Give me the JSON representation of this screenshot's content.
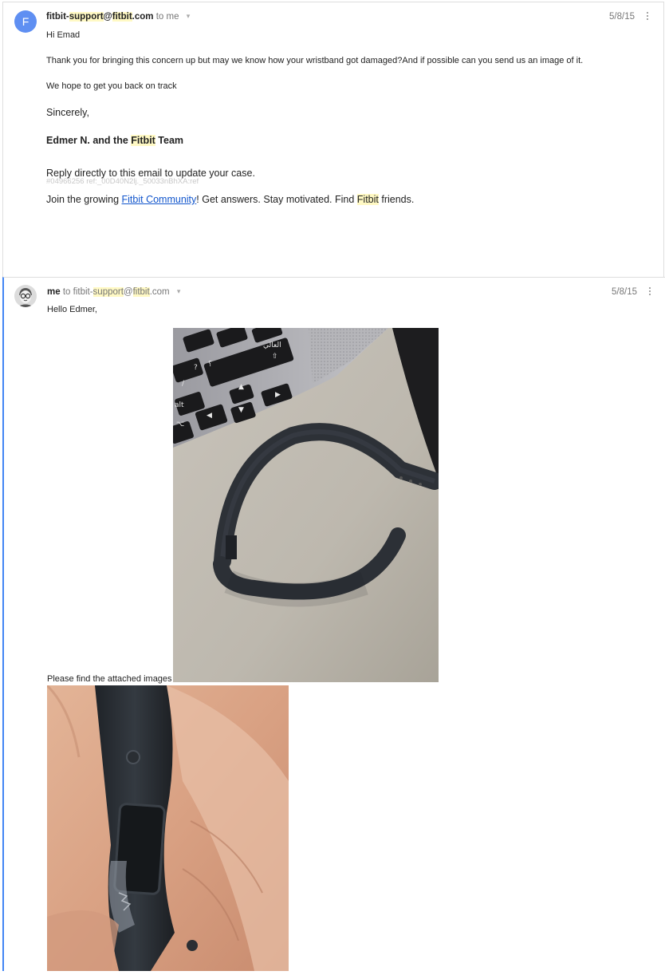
{
  "message1": {
    "avatar_letter": "F",
    "sender": {
      "prefix": "fitbit-",
      "highlight1": "support",
      "mid": "@",
      "highlight2": "fitbit",
      "suffix": ".com",
      "to": "to me"
    },
    "date": "5/8/15",
    "body": {
      "greeting": "Hi Emad",
      "para1": "Thank you for bringing this concern up but may we know how your wristband got damaged?And if possible can you send us an image of it.",
      "para2": "We hope to get you back on track",
      "closing": "Sincerely,",
      "signature": {
        "pre": "Edmer N. and the ",
        "highlight": "Fitbit",
        "post": " Team"
      },
      "reply_note": "Reply directly to this email to update your case.",
      "ref_code": "#04966256 ref:_00D40N2lj._50033nBhXA:ref",
      "community": {
        "pre": "Join the growing ",
        "link_text": "Fitbit Community",
        "mid": "! Get answers. Stay motivated. Find ",
        "highlight": "Fitbit",
        "post": " friends."
      }
    }
  },
  "message2": {
    "sender": {
      "name": "me",
      "to_word": "to",
      "to_prefix": "fitbit-",
      "to_highlight1": "support",
      "to_mid": "@",
      "to_highlight2": "fitbit",
      "to_suffix": ".com"
    },
    "date": "5/8/15",
    "body": {
      "greeting": "Hello Edmer,",
      "attachment_note": "Please find the attached images"
    },
    "photos": [
      {
        "name": "broken-band-on-laptop-photo",
        "keycap_text": "العالي"
      },
      {
        "name": "band-in-hand-photo"
      }
    ]
  },
  "colors": {
    "avatar_blue": "#5f8ff2",
    "highlight": "#fff9c4",
    "link": "#1155cc",
    "focus_border": "#4285f4"
  },
  "icons": [
    "more-options-icon",
    "details-caret-icon",
    "user-avatar-icon"
  ]
}
